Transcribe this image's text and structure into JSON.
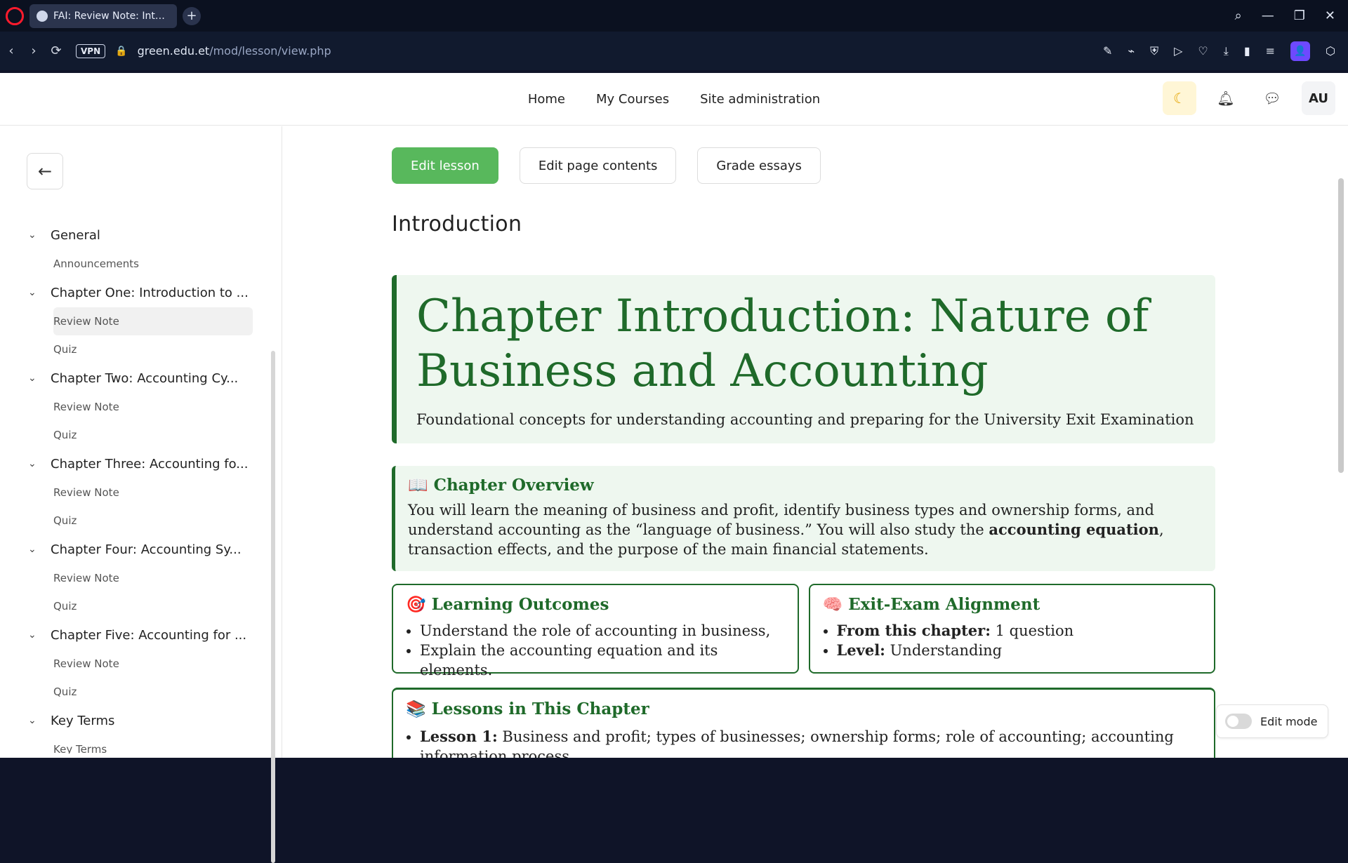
{
  "browser": {
    "tab_title": "FAI: Review Note: Introduc",
    "url_host": "green.edu.et",
    "url_path": "/mod/lesson/view.php",
    "vpn_label": "VPN"
  },
  "site_nav": {
    "items": [
      "Home",
      "My Courses",
      "Site administration"
    ],
    "avatar_initials": "AU"
  },
  "sidebar": {
    "sections": [
      {
        "title": "General",
        "items": [
          "Announcements"
        ]
      },
      {
        "title": "Chapter One: Introduction to ...",
        "items": [
          "Review Note",
          "Quiz"
        ],
        "active_index": 0
      },
      {
        "title": "Chapter Two: Accounting Cy...",
        "items": [
          "Review Note",
          "Quiz"
        ]
      },
      {
        "title": "Chapter Three: Accounting fo...",
        "items": [
          "Review Note",
          "Quiz"
        ]
      },
      {
        "title": "Chapter Four: Accounting Sy...",
        "items": [
          "Review Note",
          "Quiz"
        ]
      },
      {
        "title": "Chapter Five: Accounting for ...",
        "items": [
          "Review Note",
          "Quiz"
        ]
      },
      {
        "title": "Key Terms",
        "items": [
          "Key Terms"
        ]
      }
    ]
  },
  "actions": {
    "edit_lesson": "Edit lesson",
    "edit_page_contents": "Edit page contents",
    "grade_essays": "Grade essays"
  },
  "page": {
    "title": "Introduction",
    "hero_title": "Chapter Introduction: Nature of Business and Accounting",
    "hero_subtitle": "Foundational concepts for understanding accounting and preparing for the University Exit Examination",
    "overview_title": "Chapter Overview",
    "overview_text_part1": "You will learn the meaning of business and profit, identify business types and ownership forms, and understand accounting as the “language of business.” You will also study the ",
    "overview_bold": "accounting equation",
    "overview_text_part2": ", transaction effects, and the purpose of the main financial statements.",
    "learning_outcomes_title": "Learning Outcomes",
    "learning_outcomes": [
      "Understand the role of accounting in business,",
      "Explain the accounting equation and its elements."
    ],
    "exit_exam_title": "Exit-Exam Alignment",
    "exit_exam": [
      {
        "label": "From this chapter:",
        "value": "1 question"
      },
      {
        "label": "Level:",
        "value": "Understanding"
      }
    ],
    "lessons_title": "Lessons in This Chapter",
    "lessons": [
      {
        "label": "Lesson 1:",
        "text": "Business and profit; types of businesses; ownership forms; role of accounting; accounting information process"
      }
    ]
  },
  "edit_mode": {
    "label": "Edit mode"
  },
  "icons": {
    "back": "arrow-left-icon",
    "theme": "moon-icon",
    "bell": "bell-icon",
    "messages": "chat-icon",
    "search": "search-icon"
  },
  "colors": {
    "accent_green": "#1f6a2a",
    "primary_button": "#58b85c"
  }
}
